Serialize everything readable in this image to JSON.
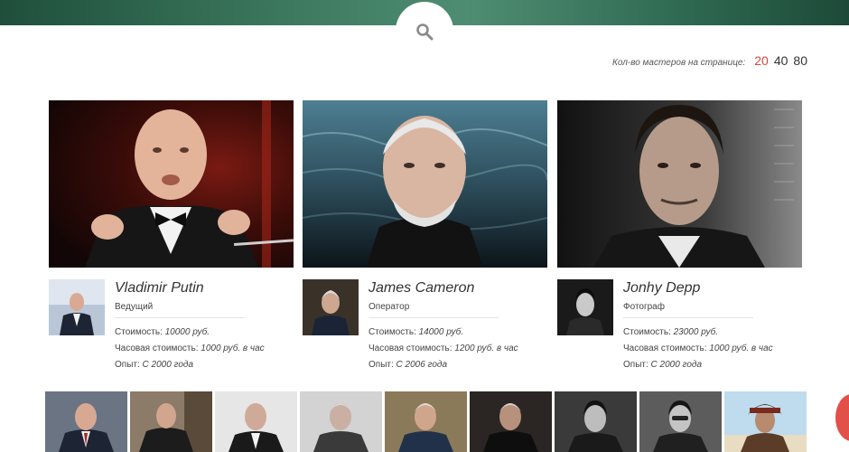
{
  "header": {
    "search_icon": "search-icon"
  },
  "per_page": {
    "label": "Кол-во мастеров на странице:",
    "options": [
      "20",
      "40",
      "80"
    ],
    "selected": "20",
    "active_color": "#e0453a"
  },
  "masters": [
    {
      "name": "Vladimir Putin",
      "role": "Ведущий",
      "price_label": "Стоимость:",
      "price": "10000 руб.",
      "hourly_label": "Часовая стоимость:",
      "hourly": "1000 руб. в час",
      "experience_label": "Опыт:",
      "experience": "С 2000 года"
    },
    {
      "name": "James Cameron",
      "role": "Оператор",
      "price_label": "Стоимость:",
      "price": "14000 руб.",
      "hourly_label": "Часовая стоимость:",
      "hourly": "1200 руб. в час",
      "experience_label": "Опыт:",
      "experience": "С 2006 года"
    },
    {
      "name": "Jonhy Depp",
      "role": "Фотограф",
      "price_label": "Стоимость:",
      "price": "23000 руб.",
      "hourly_label": "Часовая стоимость:",
      "hourly": "1000 руб. в час",
      "experience_label": "Опыт:",
      "experience": "С 2000 года"
    }
  ],
  "colors": {
    "header_green": "#3d7a5f",
    "accent_red": "#e0453a"
  }
}
